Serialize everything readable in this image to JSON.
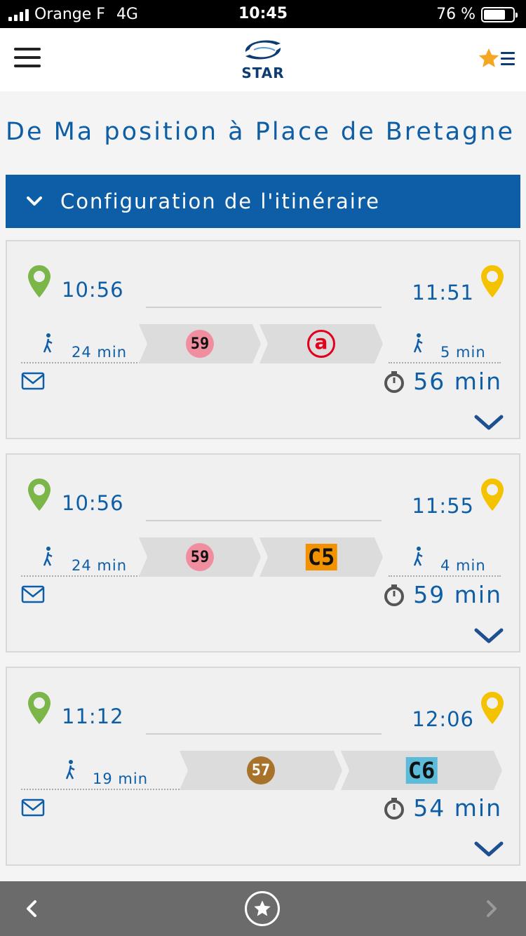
{
  "status_bar": {
    "carrier": "Orange F",
    "network": "4G",
    "time": "10:45",
    "battery": "76 %",
    "battery_level": 0.76
  },
  "header": {
    "logo_text": "STAR",
    "menu_icon": "hamburger-icon",
    "favorites_icon": "star-list-icon"
  },
  "route": {
    "title": "De Ma position à Place de Bretagne"
  },
  "config": {
    "label": "Configuration de l'itinéraire"
  },
  "colors": {
    "brand_blue": "#0d5ea6",
    "start_pin": "#7ab648",
    "end_pin": "#f5c200",
    "line_59": "#f08ea0",
    "line_57": "#a8722a",
    "line_c5": "#f39200",
    "line_c6": "#5bbbd8",
    "metro_a": "#e3001b"
  },
  "itineraries": [
    {
      "departure": "10:56",
      "arrival": "11:51",
      "walk_start": "24 min",
      "walk_end": "5 min",
      "lines": [
        "59",
        "a"
      ],
      "duration": "56 min"
    },
    {
      "departure": "10:56",
      "arrival": "11:55",
      "walk_start": "24 min",
      "walk_end": "4 min",
      "lines": [
        "59",
        "C5"
      ],
      "duration": "59 min"
    },
    {
      "departure": "11:12",
      "arrival": "12:06",
      "walk_start": "19 min",
      "walk_end": "",
      "lines": [
        "57",
        "C6"
      ],
      "duration": "54 min"
    }
  ],
  "bottom_bar": {
    "back_icon": "chevron-left-icon",
    "favorite_icon": "star-circle-icon",
    "forward_icon": "chevron-right-icon"
  }
}
